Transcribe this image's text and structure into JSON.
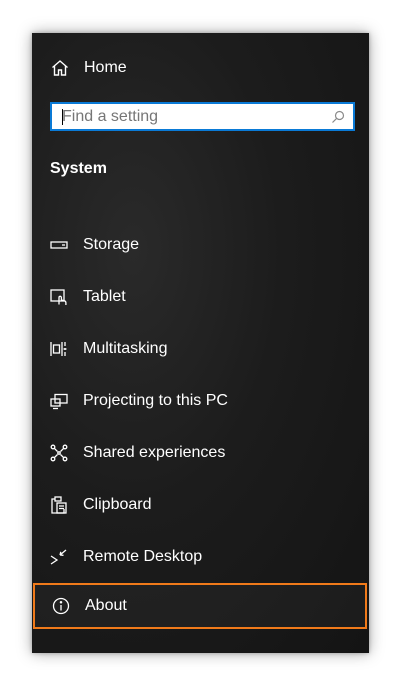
{
  "home": {
    "label": "Home",
    "icon": "home-icon"
  },
  "search": {
    "placeholder": "Find a setting",
    "value": "",
    "icon": "search-icon"
  },
  "section": {
    "title": "System"
  },
  "nav": {
    "items": [
      {
        "label": "Storage",
        "icon": "storage-icon"
      },
      {
        "label": "Tablet",
        "icon": "tablet-icon"
      },
      {
        "label": "Multitasking",
        "icon": "multitasking-icon"
      },
      {
        "label": "Projecting to this PC",
        "icon": "projecting-icon"
      },
      {
        "label": "Shared experiences",
        "icon": "shared-experiences-icon"
      },
      {
        "label": "Clipboard",
        "icon": "clipboard-icon"
      },
      {
        "label": "Remote Desktop",
        "icon": "remote-desktop-icon"
      },
      {
        "label": "About",
        "icon": "info-icon",
        "selected": true
      }
    ]
  },
  "colors": {
    "panel_background": "#1c1c1c",
    "search_border": "#0a7ad6",
    "selected_outline": "#f07a1a",
    "text": "#ffffff"
  }
}
